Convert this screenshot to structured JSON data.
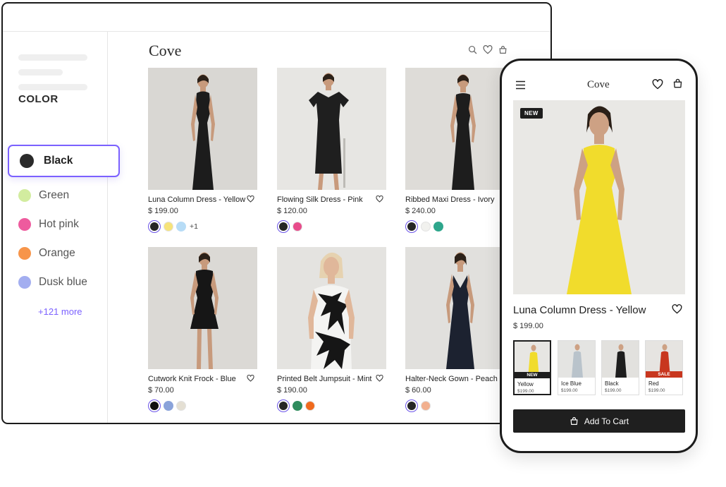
{
  "brand": "Cove",
  "filters": {
    "heading": "COLOR",
    "options": [
      {
        "label": "Black",
        "color": "#2a2a2a",
        "selected": true
      },
      {
        "label": "Green",
        "color": "#d2ec9f"
      },
      {
        "label": "Hot pink",
        "color": "#ee5b9e"
      },
      {
        "label": "Orange",
        "color": "#f7954a"
      },
      {
        "label": "Dusk blue",
        "color": "#a3aef0"
      }
    ],
    "more": "+121 more"
  },
  "desktop_icons": [
    "search-icon",
    "heart-icon",
    "bag-icon"
  ],
  "products": [
    {
      "name": "Luna Column Dress - Yellow",
      "price": "$ 199.00",
      "swatches": [
        "#262626",
        "#f6e37a",
        "#b7dcf6"
      ],
      "more_colors": "+1"
    },
    {
      "name": "Flowing Silk Dress - Pink",
      "price": "$ 120.00",
      "swatches": [
        "#262626",
        "#e84c8b"
      ]
    },
    {
      "name": "Ribbed Maxi Dress - Ivory",
      "price": "$ 240.00",
      "swatches": [
        "#262626",
        "#f1f1ee",
        "#2ea68c"
      ]
    },
    {
      "name": "Cutwork Knit Frock - Blue",
      "price": "$ 70.00",
      "swatches": [
        "#0f0f0f",
        "#8aa3da",
        "#e4dfd3"
      ]
    },
    {
      "name": "Printed Belt Jumpsuit - Mint",
      "price": "$ 190.00",
      "swatches": [
        "#262626",
        "#2f8c5d",
        "#f06a1d"
      ]
    },
    {
      "name": "Halter-Neck Gown - Peach",
      "price": "$ 60.00",
      "swatches": [
        "#262626",
        "#f2b08f"
      ]
    }
  ],
  "mobile": {
    "badge": "NEW",
    "title": "Luna Column Dress - Yellow",
    "price": "$ 199.00",
    "variants": [
      {
        "name": "Yellow",
        "price": "$199.00",
        "tag": "NEW",
        "tag_color": "#1d1d1d",
        "selected": true
      },
      {
        "name": "Ice Blue",
        "price": "$199.00"
      },
      {
        "name": "Black",
        "price": "$199.00"
      },
      {
        "name": "Red",
        "price": "$199.00",
        "tag": "SALE",
        "tag_color": "#c8361e"
      }
    ],
    "cta": "Add To Cart"
  },
  "colors": {
    "accent": "#7b61ff",
    "button": "#1f1f1f"
  }
}
